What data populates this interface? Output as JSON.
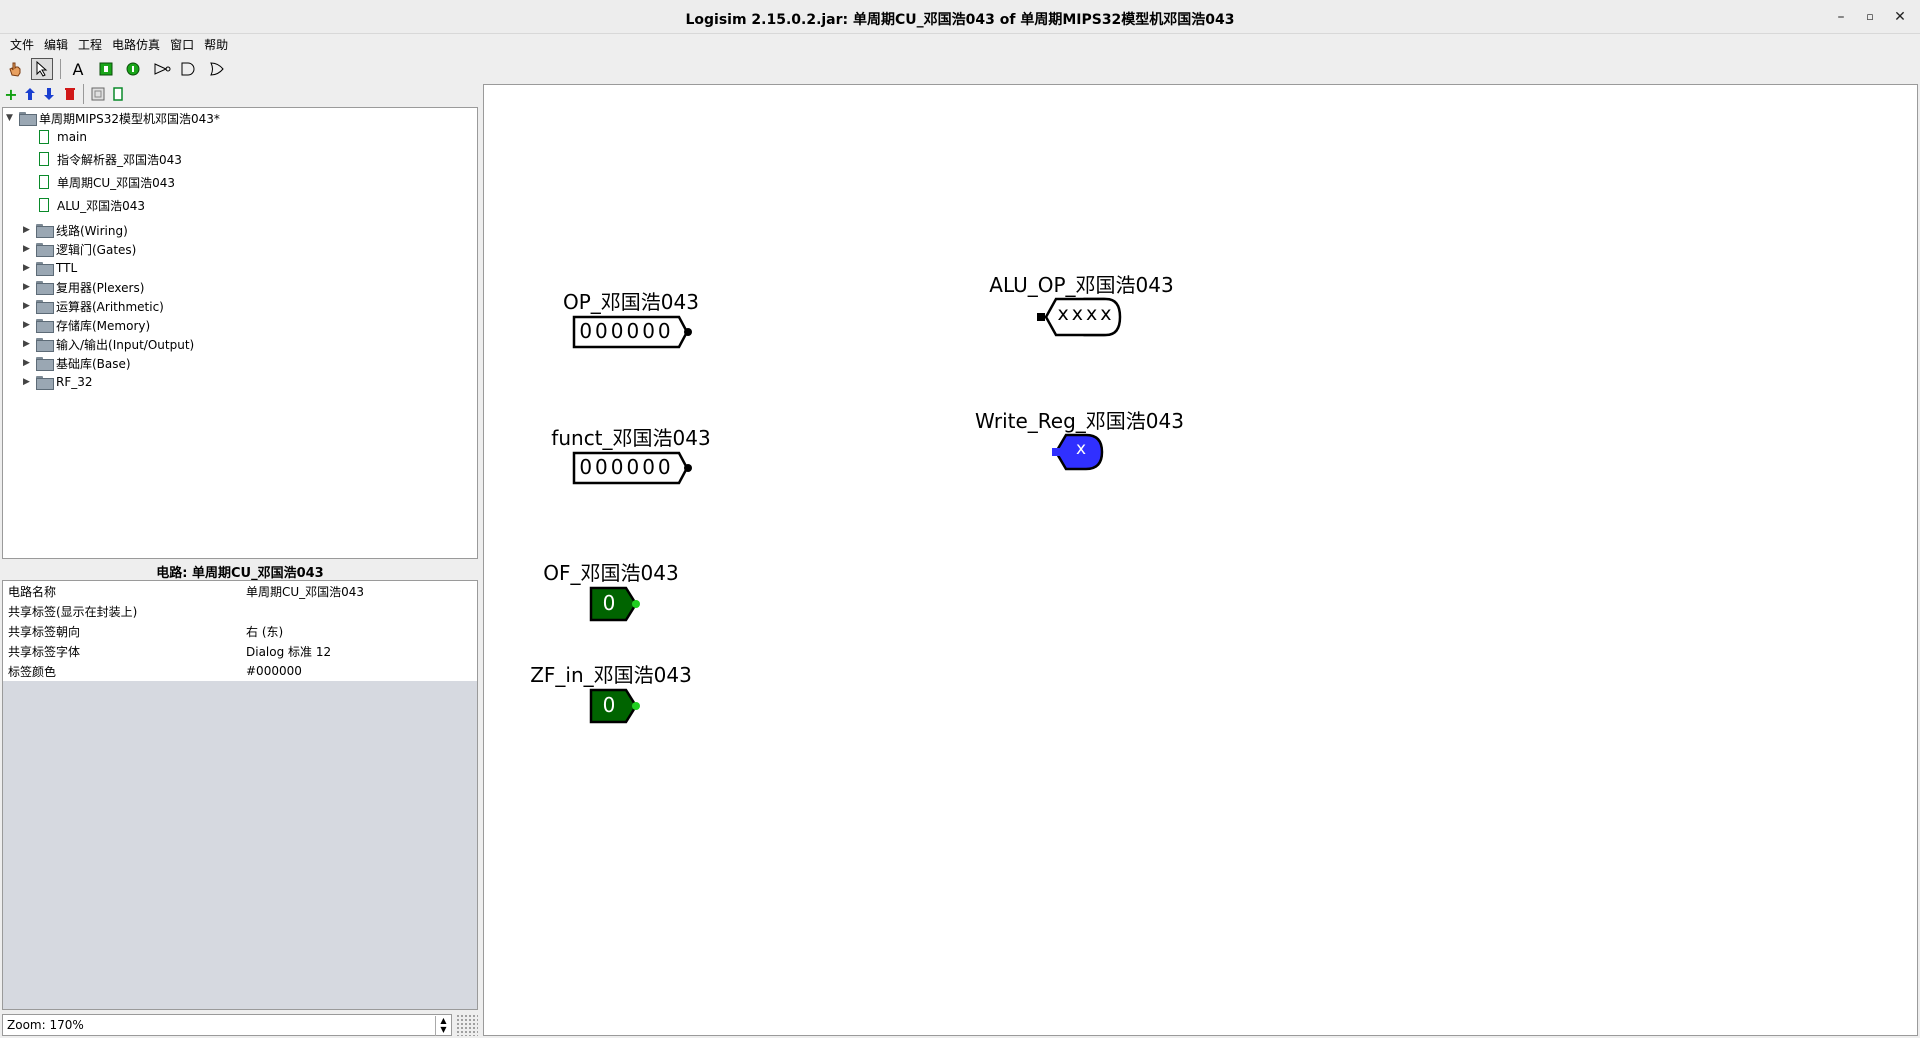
{
  "window": {
    "title": "Logisim 2.15.0.2.jar: 单周期CU_邓国浩043 of 单周期MIPS32模型机邓国浩043"
  },
  "menu": [
    "文件",
    "编辑",
    "工程",
    "电路仿真",
    "窗口",
    "帮助"
  ],
  "toolbar": {
    "tools": [
      "poke-tool-icon",
      "select-tool-icon",
      "text-tool-icon",
      "input-pin-icon",
      "output-pin-icon",
      "not-gate-icon",
      "and-gate-icon",
      "or-gate-icon"
    ],
    "project_tools": [
      "add-circuit-icon",
      "move-up-icon",
      "move-down-icon",
      "delete-circuit-icon",
      "edit-layout-icon",
      "edit-appearance-icon"
    ]
  },
  "explorer": {
    "project": "单周期MIPS32模型机邓国浩043*",
    "circuits": [
      "main",
      "指令解析器_邓国浩043",
      "单周期CU_邓国浩043",
      "ALU_邓国浩043"
    ],
    "libraries": [
      "线路(Wiring)",
      "逻辑门(Gates)",
      "TTL",
      "复用器(Plexers)",
      "运算器(Arithmetic)",
      "存储库(Memory)",
      "输入/输出(Input/Output)",
      "基础库(Base)",
      "RF_32"
    ]
  },
  "properties": {
    "header": "电路: 单周期CU_邓国浩043",
    "rows": [
      {
        "key": "电路名称",
        "value": "单周期CU_邓国浩043"
      },
      {
        "key": "共享标签(显示在封装上)",
        "value": ""
      },
      {
        "key": "共享标签朝向",
        "value": "右 (东)"
      },
      {
        "key": "共享标签字体",
        "value": "Dialog 标准 12"
      },
      {
        "key": "标签颜色",
        "value": "#000000"
      }
    ]
  },
  "zoom": "Zoom: 170%",
  "canvas": {
    "components": {
      "op_label": "OP_邓国浩043",
      "op_value": "000000",
      "funct_label": "funct_邓国浩043",
      "funct_value": "000000",
      "of_label": "OF_邓国浩043",
      "of_value": "0",
      "zf_label": "ZF_in_邓国浩043",
      "zf_value": "0",
      "aluop_label": "ALU_OP_邓国浩043",
      "aluop_value": "xxxx",
      "writereg_label": "Write_Reg_邓国浩043",
      "writereg_value": "x"
    }
  },
  "colors": {
    "pin_green": "#006400",
    "pin_blue": "#2a2aff",
    "canvas_bg": "#ffffff"
  }
}
